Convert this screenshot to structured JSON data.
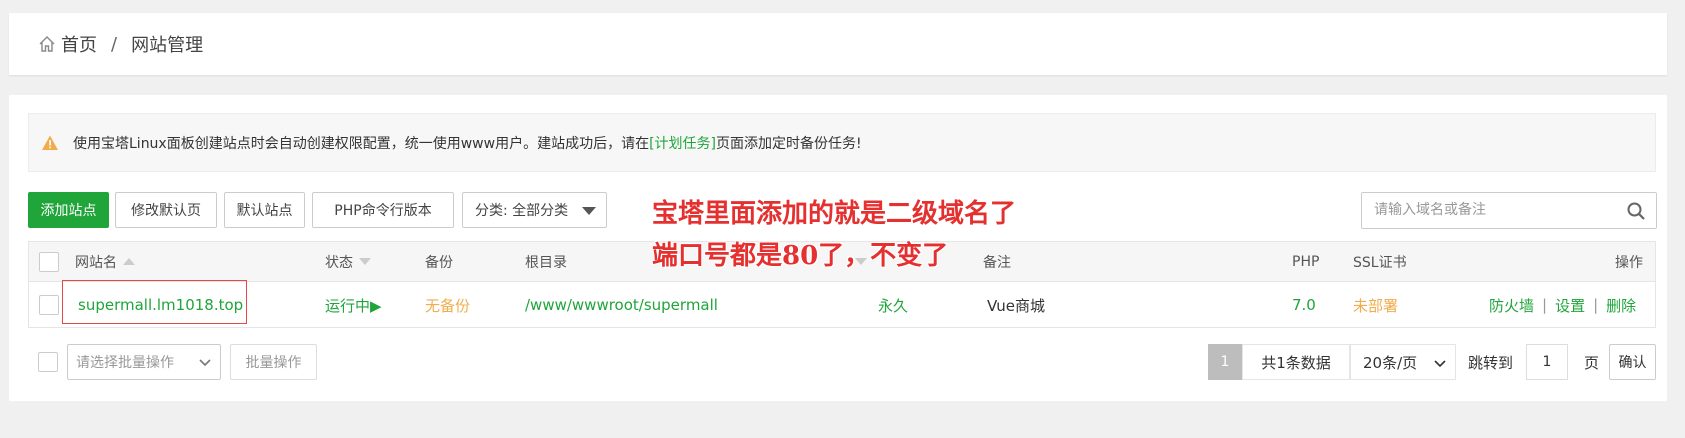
{
  "breadcrumb": {
    "home": "首页",
    "separator": "/",
    "current": "网站管理"
  },
  "notice": {
    "text_before": "使用宝塔Linux面板创建站点时会自动创建权限配置，统一使用www用户。建站成功后，请在",
    "link": "[计划任务]",
    "text_after": "页面添加定时备份任务!"
  },
  "toolbar": {
    "add_site": "添加站点",
    "modify_default_page": "修改默认页",
    "default_site": "默认站点",
    "php_cli_version": "PHP命令行版本",
    "category_select": "分类: 全部分类",
    "search_placeholder": "请输入域名或备注"
  },
  "table": {
    "headers": {
      "site_name": "网站名",
      "status": "状态",
      "backup": "备份",
      "root": "根目录",
      "remark": "备注",
      "php": "PHP",
      "ssl": "SSL证书",
      "actions": "操作"
    },
    "rows": [
      {
        "site_name": "supermall.lm1018.top",
        "status": "运行中▶",
        "backup": "无备份",
        "root": "/www/wwwroot/supermall",
        "expire": "永久",
        "remark": "Vue商城",
        "php": "7.0",
        "ssl": "未部署",
        "action_firewall": "防火墙",
        "action_settings": "设置",
        "action_delete": "删除",
        "action_sep": "|"
      }
    ]
  },
  "annotations": {
    "line1": "宝塔里面添加的就是二级域名了",
    "line2": "端口号都是80了，不变了"
  },
  "footer": {
    "batch_placeholder": "请选择批量操作",
    "batch_button": "批量操作",
    "current_page": "1",
    "total": "共1条数据",
    "page_size": "20条/页",
    "jump_label": "跳转到",
    "jump_value": "1",
    "page_unit": "页",
    "confirm": "确认"
  },
  "colors": {
    "accent": "#20a53a",
    "warning": "#f0ad4e",
    "annotation": "#e53030"
  }
}
